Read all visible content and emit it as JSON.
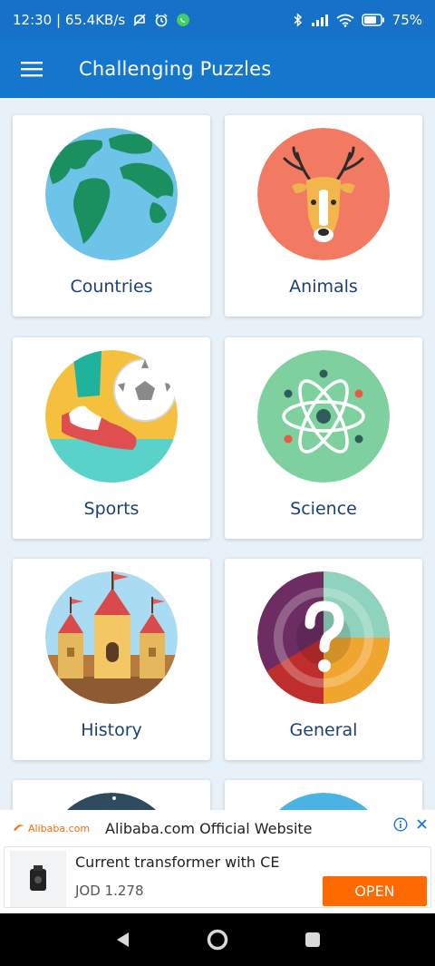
{
  "status_bar": {
    "time_speed": "12:30 | 65.4KB/s",
    "battery": "75%",
    "icons": [
      "mute-icon",
      "alarm-icon",
      "whatsapp-icon",
      "bluetooth-icon",
      "signal-icon",
      "wifi-icon",
      "battery-icon"
    ]
  },
  "app_bar": {
    "title": "Challenging Puzzles",
    "menu_icon": "hamburger-menu-icon",
    "color": "#1477cd"
  },
  "categories": [
    {
      "label": "Countries",
      "icon": "globe-icon"
    },
    {
      "label": "Animals",
      "icon": "deer-icon"
    },
    {
      "label": "Sports",
      "icon": "soccer-icon"
    },
    {
      "label": "Science",
      "icon": "atom-icon"
    },
    {
      "label": "History",
      "icon": "castle-icon"
    },
    {
      "label": "General",
      "icon": "question-icon"
    }
  ],
  "ad": {
    "brand": "Alibaba.com",
    "title": "Alibaba.com Official Website",
    "product": "Current transformer with CE",
    "price": "JOD 1.278",
    "button": "OPEN",
    "accent": "#ff6a00"
  },
  "nav_bar": {
    "buttons": [
      "back-icon",
      "home-icon",
      "recents-icon"
    ]
  }
}
